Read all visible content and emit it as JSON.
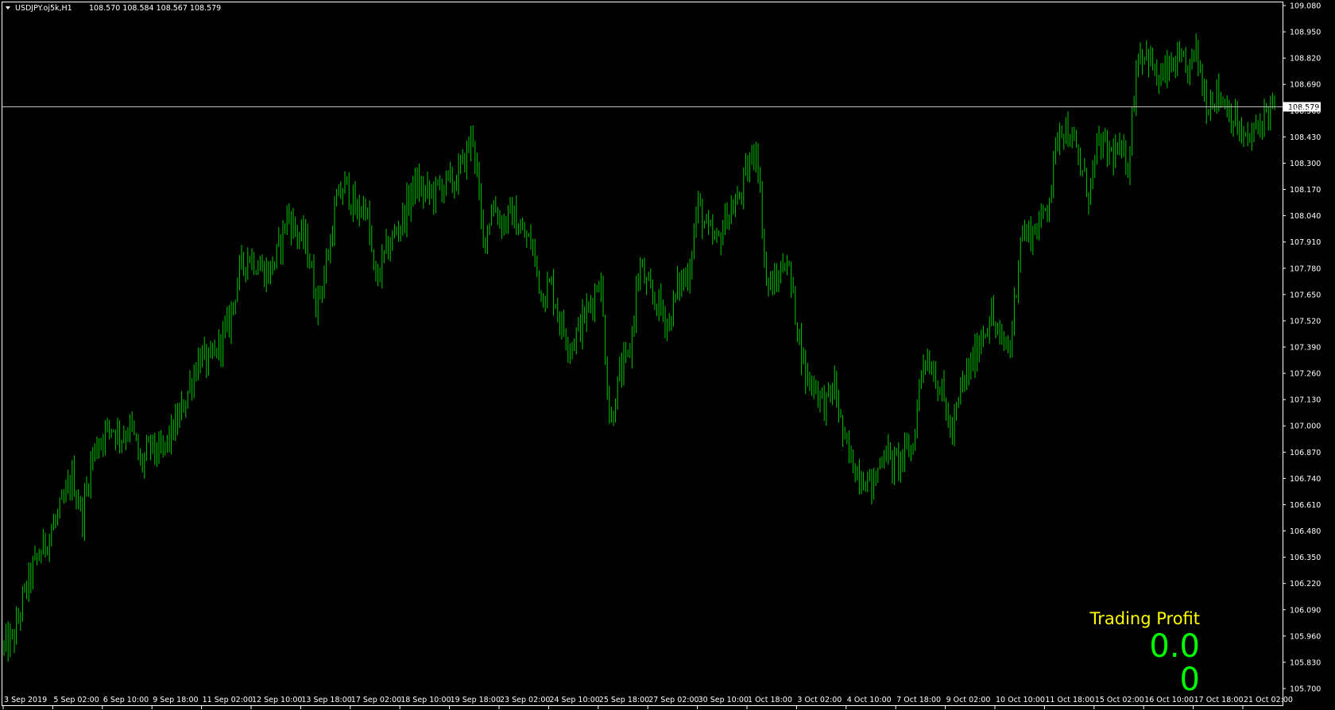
{
  "header": {
    "symbol_label": "USDJPY.oj5k,H1",
    "ohlc": "108.570 108.584 108.567 108.579",
    "menu_icon": "triangle-down-icon"
  },
  "colors": {
    "background": "#000000",
    "candle": "#00c800",
    "text": "#ffffff",
    "bid_line": "#c0c0c0",
    "profit_label": "#ffff00",
    "profit_value": "#00ff00"
  },
  "price_axis": {
    "min": 105.7,
    "max": 109.08,
    "ticks": [
      "109.080",
      "108.950",
      "108.820",
      "108.690",
      "108.560",
      "108.430",
      "108.300",
      "108.170",
      "108.040",
      "107.910",
      "107.780",
      "107.650",
      "107.520",
      "107.390",
      "107.260",
      "107.130",
      "107.000",
      "106.870",
      "106.740",
      "106.610",
      "106.480",
      "106.350",
      "106.220",
      "106.090",
      "105.960",
      "105.830",
      "105.700"
    ],
    "current_price": "108.579"
  },
  "time_axis": {
    "labels": [
      "3 Sep 2019",
      "5 Sep 02:00",
      "6 Sep 10:00",
      "9 Sep 18:00",
      "11 Sep 02:00",
      "12 Sep 10:00",
      "13 Sep 18:00",
      "17 Sep 02:00",
      "18 Sep 10:00",
      "19 Sep 18:00",
      "23 Sep 02:00",
      "24 Sep 10:00",
      "25 Sep 18:00",
      "27 Sep 02:00",
      "30 Sep 10:00",
      "1 Oct 18:00",
      "3 Oct 02:00",
      "4 Oct 10:00",
      "7 Oct 18:00",
      "9 Oct 02:00",
      "10 Oct 10:00",
      "11 Oct 18:00",
      "15 Oct 02:00",
      "16 Oct 10:00",
      "17 Oct 18:00",
      "21 Oct 02:00"
    ]
  },
  "chart_data": {
    "type": "line",
    "series": [
      {
        "values": [
          105.9,
          105.95,
          106.15,
          106.3,
          106.4,
          106.5,
          106.6,
          106.75,
          106.55,
          106.85,
          106.95,
          107.0,
          106.95,
          107.0,
          106.8,
          106.9,
          106.85,
          106.95,
          107.05,
          107.2,
          107.35,
          107.3,
          107.4,
          107.5,
          107.75,
          107.85,
          107.8,
          107.75,
          107.85,
          108.05,
          107.95,
          107.9,
          107.6,
          107.8,
          108.1,
          108.2,
          108.05,
          108.1,
          107.7,
          107.85,
          107.95,
          108.05,
          108.2,
          108.15,
          108.15,
          108.2,
          108.2,
          108.3,
          108.45,
          107.9,
          108.1,
          108.0,
          108.05,
          107.95,
          107.9,
          107.65,
          107.7,
          107.5,
          107.4,
          107.5,
          107.6,
          107.75,
          107.0,
          107.25,
          107.35,
          107.8,
          107.65,
          107.6,
          107.5,
          107.7,
          107.75,
          108.1,
          107.95,
          107.9,
          108.05,
          108.1,
          108.25,
          108.4,
          107.7,
          107.7,
          107.85,
          107.55,
          107.25,
          107.2,
          107.1,
          107.2,
          106.9,
          106.8,
          106.75,
          106.7,
          106.9,
          106.8,
          106.85,
          106.9,
          107.35,
          107.3,
          107.15,
          106.95,
          107.2,
          107.3,
          107.45,
          107.55,
          107.4,
          107.4,
          107.95,
          107.95,
          108.0,
          108.15,
          108.5,
          108.45,
          108.3,
          108.15,
          108.4,
          108.35,
          108.35,
          108.3,
          108.85,
          108.85,
          108.7,
          108.75,
          108.8,
          108.75,
          108.85,
          108.6,
          108.65,
          108.6,
          108.5,
          108.4,
          108.45,
          108.55,
          108.58
        ]
      }
    ],
    "x_labels": [
      "3 Sep 2019",
      "5 Sep 02:00",
      "6 Sep 10:00",
      "9 Sep 18:00",
      "11 Sep 02:00",
      "12 Sep 10:00",
      "13 Sep 18:00",
      "17 Sep 02:00",
      "18 Sep 10:00",
      "19 Sep 18:00",
      "23 Sep 02:00",
      "24 Sep 10:00",
      "25 Sep 18:00",
      "27 Sep 02:00",
      "30 Sep 10:00",
      "1 Oct 18:00",
      "3 Oct 02:00",
      "4 Oct 10:00",
      "7 Oct 18:00",
      "9 Oct 02:00",
      "10 Oct 10:00",
      "11 Oct 18:00",
      "15 Oct 02:00",
      "16 Oct 10:00",
      "17 Oct 18:00",
      "21 Oct 02:00"
    ],
    "ylim": [
      105.7,
      109.08
    ],
    "grid": false
  },
  "overlay": {
    "label": "Trading Profit",
    "value_1": "0.0",
    "value_2": "0"
  }
}
